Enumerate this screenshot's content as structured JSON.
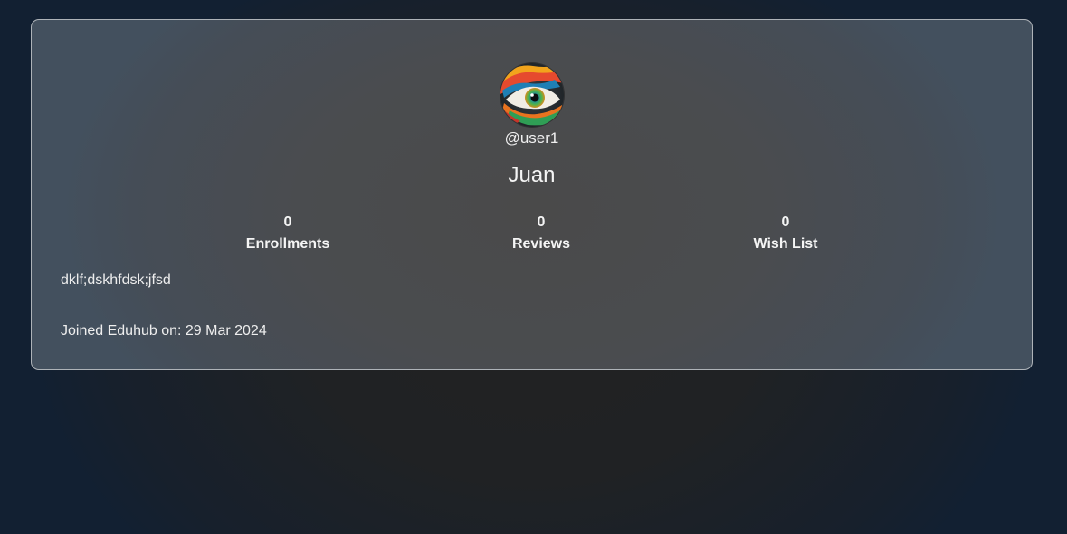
{
  "profile": {
    "username": "@user1",
    "display_name": "Juan",
    "avatar_icon": "eye-artwork-avatar",
    "stats": [
      {
        "value": "0",
        "label": "Enrollments"
      },
      {
        "value": "0",
        "label": "Reviews"
      },
      {
        "value": "0",
        "label": "Wish List"
      }
    ],
    "bio": "dklf;dskhfdsk;jfsd",
    "joined": "Joined Eduhub on: 29 Mar 2024"
  },
  "colors": {
    "card_border": "#aeb3b8",
    "text": "#f2f2f2",
    "page_edge": "#122032"
  }
}
